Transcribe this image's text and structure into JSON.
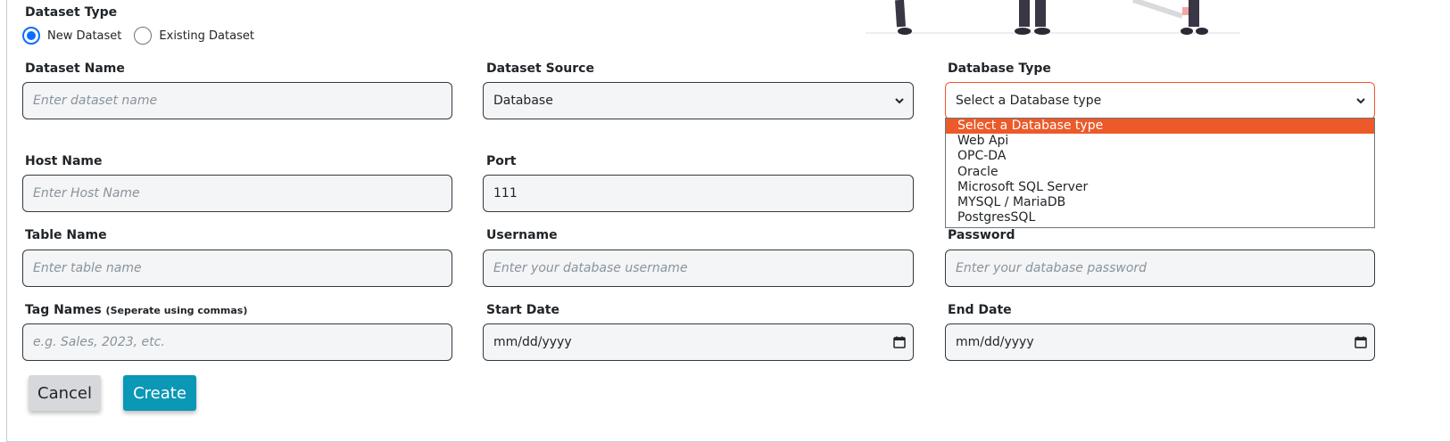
{
  "dataset_type": {
    "label": "Dataset Type",
    "options": [
      {
        "label": "New Dataset",
        "checked": true
      },
      {
        "label": "Existing Dataset",
        "checked": false
      }
    ]
  },
  "dataset_name": {
    "label": "Dataset Name",
    "placeholder": "Enter dataset name"
  },
  "dataset_source": {
    "label": "Dataset Source",
    "value": "Database"
  },
  "database_type": {
    "label": "Database Type",
    "value": "Select a Database type",
    "options": [
      "Select a Database type",
      "Web Api",
      "OPC-DA",
      "Oracle",
      "Microsoft SQL Server",
      "MYSQL / MariaDB",
      "PostgresSQL"
    ],
    "highlighted": "Select a Database type"
  },
  "host_name": {
    "label": "Host Name",
    "placeholder": "Enter Host Name"
  },
  "port": {
    "label": "Port",
    "value": "111"
  },
  "table_name": {
    "label": "Table Name",
    "placeholder": "Enter table name"
  },
  "username": {
    "label": "Username",
    "placeholder": "Enter your database username"
  },
  "password": {
    "label": "Password",
    "placeholder": "Enter your database password"
  },
  "tag_names": {
    "label": "Tag Names",
    "hint": "(Seperate using commas)",
    "placeholder": "e.g. Sales, 2023, etc."
  },
  "start_date": {
    "label": "Start Date",
    "value": "mm/dd/yyyy"
  },
  "end_date": {
    "label": "End Date",
    "value": "mm/dd/yyyy"
  },
  "actions": {
    "cancel": "Cancel",
    "create": "Create"
  },
  "colors": {
    "accent": "#ec5a29",
    "primary": "#0b97b6",
    "radio": "#0d6efd"
  },
  "icons": {
    "select": "chevron-down-icon",
    "date": "calendar-icon"
  }
}
